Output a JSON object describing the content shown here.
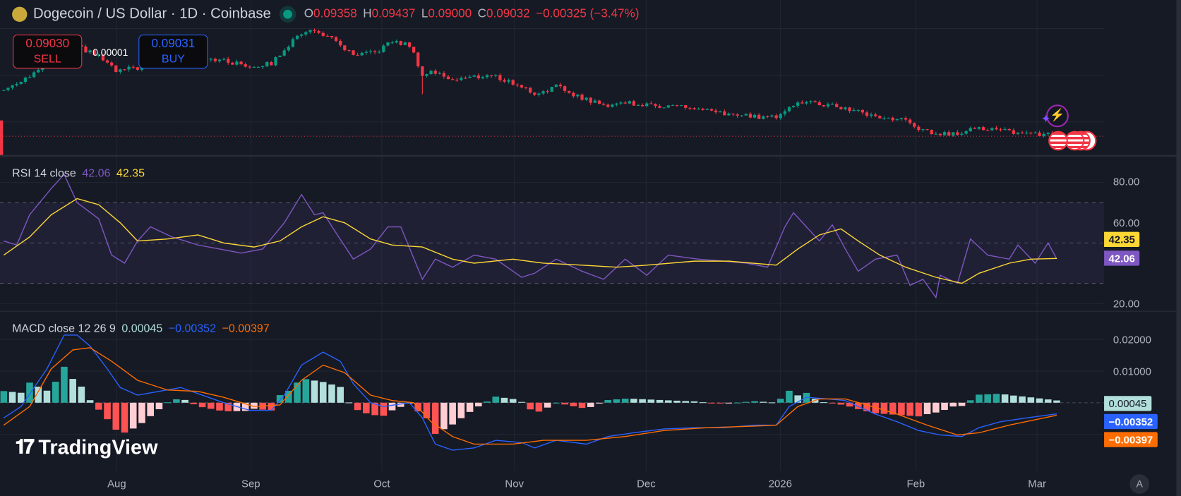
{
  "header": {
    "title": "Dogecoin / US Dollar · 1D · Coinbase",
    "o_label": "O",
    "o": "0.09358",
    "h_label": "H",
    "h": "0.09437",
    "l_label": "L",
    "l": "0.09000",
    "c_label": "C",
    "c": "0.09032",
    "change": "−0.00325 (−3.47%)"
  },
  "trade": {
    "sell_price": "0.09030",
    "sell_label": "SELL",
    "spread": "0.00001",
    "buy_price": "0.09031",
    "buy_label": "BUY"
  },
  "rsi": {
    "label": "RSI 14 close",
    "value": "42.06",
    "ma_value": "42.35",
    "ticks": [
      "80.00",
      "60.00",
      "20.00"
    ]
  },
  "macd": {
    "label": "MACD close 12 26 9",
    "hist_value": "0.00045",
    "macd_value": "−0.00352",
    "signal_value": "−0.00397",
    "ticks": [
      "0.02000",
      "0.01000"
    ]
  },
  "time_axis": [
    "Aug",
    "Sep",
    "Oct",
    "Nov",
    "Dec",
    "2026",
    "Feb",
    "Mar"
  ],
  "branding": {
    "logo_text": "TradingView"
  },
  "auto_scale_label": "A",
  "colors": {
    "up": "#089981",
    "down": "#f23645",
    "rsi": "#7e57c2",
    "rsi_ma": "#fdd835",
    "macd": "#2962ff",
    "signal": "#ff6d00"
  },
  "chart_data": {
    "type": "candlestick",
    "start_date": "2025-07-06",
    "x_unit": "days since start_date",
    "price_close_points": [
      [
        0,
        0.149
      ],
      [
        6,
        0.1755
      ],
      [
        11,
        0.199
      ],
      [
        16,
        0.244
      ],
      [
        22,
        0.216
      ],
      [
        26,
        0.183
      ],
      [
        31,
        0.191
      ],
      [
        36,
        0.216
      ],
      [
        45,
        0.216
      ],
      [
        50,
        0.207
      ],
      [
        57,
        0.194
      ],
      [
        62,
        0.199
      ],
      [
        65,
        0.234
      ],
      [
        70,
        0.288
      ],
      [
        74,
        0.276
      ],
      [
        78,
        0.244
      ],
      [
        81,
        0.216
      ],
      [
        86,
        0.225
      ],
      [
        90,
        0.254
      ],
      [
        94,
        0.244
      ],
      [
        97,
        0.1755
      ],
      [
        99,
        0.183
      ],
      [
        104,
        0.168
      ],
      [
        113,
        0.1755
      ],
      [
        120,
        0.155
      ],
      [
        123,
        0.143
      ],
      [
        128,
        0.155
      ],
      [
        134,
        0.137
      ],
      [
        139,
        0.126
      ],
      [
        144,
        0.131
      ],
      [
        149,
        0.126
      ],
      [
        156,
        0.126
      ],
      [
        165,
        0.116
      ],
      [
        174,
        0.1115
      ],
      [
        179,
        0.1115
      ],
      [
        182,
        0.126
      ],
      [
        186,
        0.131
      ],
      [
        191,
        0.126
      ],
      [
        196,
        0.121
      ],
      [
        202,
        0.1115
      ],
      [
        209,
        0.107
      ],
      [
        211,
        0.0986
      ],
      [
        216,
        0.0922
      ],
      [
        221,
        0.0922
      ],
      [
        224,
        0.1
      ],
      [
        226,
        0.0986
      ],
      [
        233,
        0.0946
      ],
      [
        240,
        0.0922
      ],
      [
        244,
        0.09032
      ]
    ],
    "rsi": [
      [
        0,
        51
      ],
      [
        3,
        49
      ],
      [
        6,
        64
      ],
      [
        11,
        77
      ],
      [
        14,
        84
      ],
      [
        17,
        70
      ],
      [
        22,
        62
      ],
      [
        25,
        44
      ],
      [
        28,
        40
      ],
      [
        31,
        51
      ],
      [
        34,
        58
      ],
      [
        39,
        53
      ],
      [
        45,
        49
      ],
      [
        50,
        47
      ],
      [
        55,
        45
      ],
      [
        60,
        47
      ],
      [
        65,
        60
      ],
      [
        69,
        74
      ],
      [
        72,
        64
      ],
      [
        74,
        65
      ],
      [
        77,
        55
      ],
      [
        81,
        42
      ],
      [
        85,
        47
      ],
      [
        89,
        58
      ],
      [
        92,
        58
      ],
      [
        97,
        32
      ],
      [
        100,
        42
      ],
      [
        104,
        38
      ],
      [
        109,
        44
      ],
      [
        114,
        42
      ],
      [
        120,
        33
      ],
      [
        123,
        35
      ],
      [
        128,
        42
      ],
      [
        134,
        36
      ],
      [
        139,
        32
      ],
      [
        144,
        42
      ],
      [
        149,
        34
      ],
      [
        154,
        44
      ],
      [
        161,
        42
      ],
      [
        167,
        41
      ],
      [
        172,
        40
      ],
      [
        177,
        38
      ],
      [
        181,
        58
      ],
      [
        183,
        65
      ],
      [
        186,
        58
      ],
      [
        189,
        51
      ],
      [
        192,
        59
      ],
      [
        195,
        47
      ],
      [
        198,
        36
      ],
      [
        202,
        42
      ],
      [
        207,
        44
      ],
      [
        210,
        29
      ],
      [
        213,
        32
      ],
      [
        216,
        23
      ],
      [
        217,
        34
      ],
      [
        221,
        30
      ],
      [
        224,
        52
      ],
      [
        228,
        44
      ],
      [
        233,
        42
      ],
      [
        235,
        49
      ],
      [
        239,
        40
      ],
      [
        242,
        50
      ],
      [
        244,
        42.06
      ]
    ],
    "rsi_ma": [
      [
        0,
        44
      ],
      [
        6,
        53
      ],
      [
        11,
        64
      ],
      [
        17,
        72
      ],
      [
        22,
        69
      ],
      [
        27,
        60
      ],
      [
        31,
        51
      ],
      [
        38,
        52
      ],
      [
        45,
        54
      ],
      [
        51,
        50
      ],
      [
        58,
        48
      ],
      [
        64,
        51
      ],
      [
        69,
        58
      ],
      [
        74,
        63
      ],
      [
        79,
        60
      ],
      [
        85,
        52
      ],
      [
        90,
        49
      ],
      [
        97,
        48
      ],
      [
        104,
        42
      ],
      [
        109,
        40
      ],
      [
        118,
        42
      ],
      [
        125,
        40
      ],
      [
        134,
        39
      ],
      [
        142,
        38
      ],
      [
        149,
        39
      ],
      [
        160,
        41
      ],
      [
        168,
        41
      ],
      [
        179,
        39
      ],
      [
        184,
        47
      ],
      [
        189,
        54
      ],
      [
        194,
        57
      ],
      [
        198,
        51
      ],
      [
        203,
        44
      ],
      [
        209,
        38
      ],
      [
        216,
        33
      ],
      [
        222,
        30
      ],
      [
        226,
        35
      ],
      [
        233,
        40
      ],
      [
        238,
        42
      ],
      [
        244,
        42.35
      ]
    ],
    "rsi_range": [
      10,
      90
    ],
    "rsi_bands": [
      70,
      50,
      30
    ],
    "macd": [
      [
        0,
        -0.0048
      ],
      [
        4,
        -0.0012
      ],
      [
        10,
        0.0107
      ],
      [
        14,
        0.0214
      ],
      [
        17,
        0.0214
      ],
      [
        20,
        0.0179
      ],
      [
        24,
        0.0107
      ],
      [
        27,
        0.0048
      ],
      [
        31,
        0.0024
      ],
      [
        36,
        0.0036
      ],
      [
        41,
        0.0048
      ],
      [
        46,
        0.0024
      ],
      [
        51,
        0
      ],
      [
        57,
        -0.0024
      ],
      [
        62,
        -0.0024
      ],
      [
        65,
        0.0024
      ],
      [
        69,
        0.0119
      ],
      [
        74,
        0.016
      ],
      [
        78,
        0.0131
      ],
      [
        81,
        0.006
      ],
      [
        85,
        0
      ],
      [
        88,
        -0.0012
      ],
      [
        94,
        0
      ],
      [
        97,
        -0.0048
      ],
      [
        100,
        -0.0131
      ],
      [
        104,
        -0.015
      ],
      [
        109,
        -0.0143
      ],
      [
        114,
        -0.0119
      ],
      [
        120,
        -0.0126
      ],
      [
        123,
        -0.0143
      ],
      [
        128,
        -0.0119
      ],
      [
        135,
        -0.0131
      ],
      [
        140,
        -0.0107
      ],
      [
        146,
        -0.0095
      ],
      [
        153,
        -0.0083
      ],
      [
        160,
        -0.0079
      ],
      [
        167,
        -0.0079
      ],
      [
        174,
        -0.0071
      ],
      [
        179,
        -0.0071
      ],
      [
        182,
        -0.0012
      ],
      [
        186,
        0.0017
      ],
      [
        191,
        0.0012
      ],
      [
        195,
        0.0007
      ],
      [
        198,
        -0.0012
      ],
      [
        202,
        -0.0036
      ],
      [
        207,
        -0.006
      ],
      [
        212,
        -0.0088
      ],
      [
        217,
        -0.0102
      ],
      [
        222,
        -0.0107
      ],
      [
        226,
        -0.0079
      ],
      [
        231,
        -0.006
      ],
      [
        237,
        -0.0048
      ],
      [
        244,
        -0.00352
      ]
    ],
    "signal": [
      [
        0,
        -0.0071
      ],
      [
        6,
        -0.0012
      ],
      [
        11,
        0.0107
      ],
      [
        16,
        0.0167
      ],
      [
        20,
        0.0174
      ],
      [
        25,
        0.0131
      ],
      [
        31,
        0.0071
      ],
      [
        38,
        0.004
      ],
      [
        45,
        0.0036
      ],
      [
        51,
        0.0017
      ],
      [
        58,
        -0.0012
      ],
      [
        64,
        -0.0007
      ],
      [
        69,
        0.0071
      ],
      [
        74,
        0.0119
      ],
      [
        79,
        0.0095
      ],
      [
        85,
        0.0024
      ],
      [
        90,
        0.0007
      ],
      [
        95,
        0
      ],
      [
        99,
        -0.006
      ],
      [
        104,
        -0.0107
      ],
      [
        109,
        -0.0131
      ],
      [
        118,
        -0.0131
      ],
      [
        125,
        -0.0119
      ],
      [
        135,
        -0.0119
      ],
      [
        144,
        -0.0107
      ],
      [
        153,
        -0.0088
      ],
      [
        163,
        -0.0079
      ],
      [
        174,
        -0.0074
      ],
      [
        179,
        -0.0071
      ],
      [
        184,
        -0.0012
      ],
      [
        189,
        0.0012
      ],
      [
        195,
        0.0012
      ],
      [
        200,
        -0.0007
      ],
      [
        207,
        -0.0036
      ],
      [
        214,
        -0.0071
      ],
      [
        221,
        -0.0102
      ],
      [
        226,
        -0.0095
      ],
      [
        233,
        -0.0071
      ],
      [
        244,
        -0.00397
      ]
    ]
  }
}
